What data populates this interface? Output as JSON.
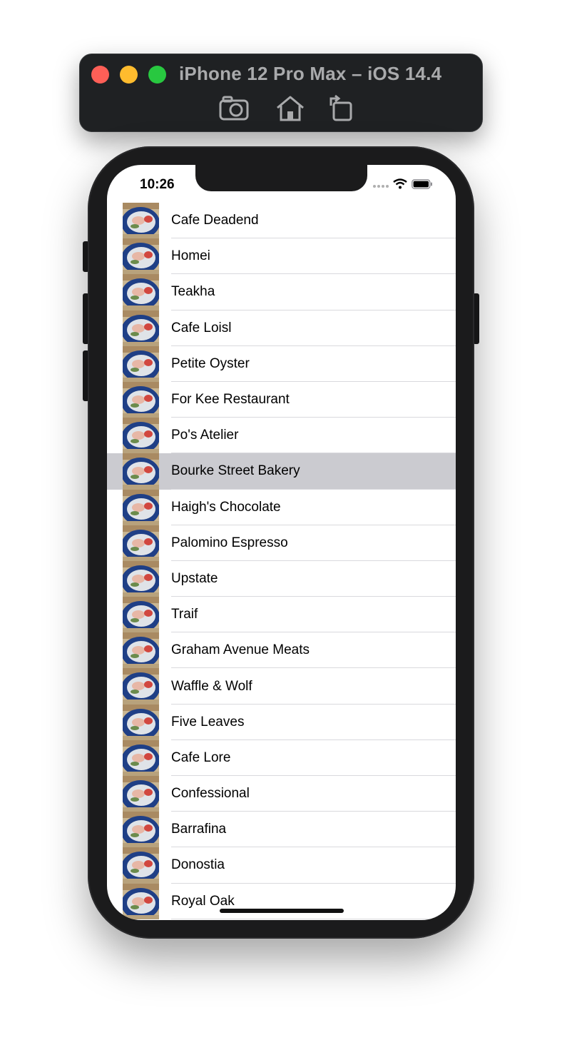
{
  "simulator": {
    "title": "iPhone 12 Pro Max – iOS 14.4",
    "tools": [
      "screenshot-camera-icon",
      "home-icon",
      "rotate-icon"
    ]
  },
  "status_bar": {
    "time": "10:26",
    "icons": [
      "cellular-signal-icon",
      "wifi-icon",
      "battery-icon"
    ]
  },
  "list": {
    "selected_index": 7,
    "items": [
      "Cafe Deadend",
      "Homei",
      "Teakha",
      "Cafe Loisl",
      "Petite Oyster",
      "For Kee Restaurant",
      "Po's Atelier",
      "Bourke Street Bakery",
      "Haigh's Chocolate",
      "Palomino Espresso",
      "Upstate",
      "Traif",
      "Graham Avenue Meats",
      "Waffle & Wolf",
      "Five Leaves",
      "Cafe Lore",
      "Confessional",
      "Barrafina",
      "Donostia",
      "Royal Oak"
    ]
  },
  "colors": {
    "selected_row": "#cbcbd0",
    "separator": "#d9d9dd",
    "sim_bar": "#1f2123",
    "device": "#1b1b1c"
  }
}
